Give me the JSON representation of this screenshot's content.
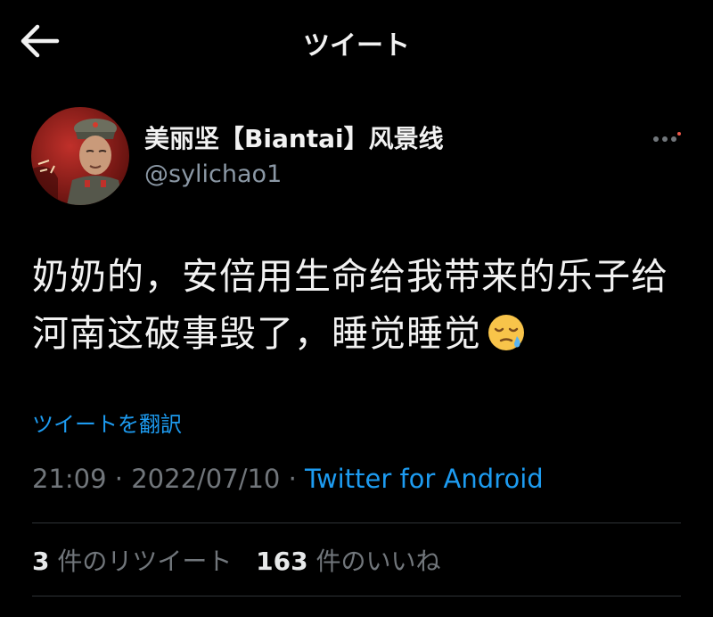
{
  "header": {
    "title": "ツイート",
    "back_icon": "arrow-left-icon"
  },
  "author": {
    "name": "美丽坚【Biantai】风景线",
    "handle": "@sylichao1",
    "avatar_icon": "avatar-portrait",
    "more_icon": "more-dots-icon"
  },
  "tweet": {
    "text": "奶奶的，安倍用生命给我带来的乐子给河南这破事毁了，睡觉睡觉",
    "emoji": "sleepy-face-icon",
    "translate_label": "ツイートを翻訳"
  },
  "meta": {
    "time": "21:09",
    "date": "2022/07/10",
    "separator": "·",
    "source": "Twitter for Android"
  },
  "stats": {
    "retweets_count": "3",
    "retweets_label": "件のリツイート",
    "likes_count": "163",
    "likes_label": "件のいいね"
  },
  "colors": {
    "background": "#000000",
    "text": "#e7e9ea",
    "muted": "#71767b",
    "link": "#1d9bf0",
    "divider": "#2f3336"
  }
}
